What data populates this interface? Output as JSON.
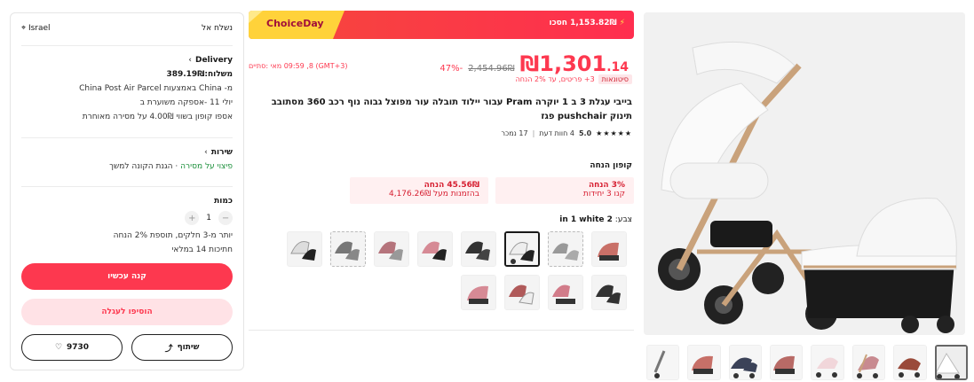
{
  "banner": {
    "brand": "ChoiceDay",
    "save_amount": "1,153.82₪ חסכו",
    "bolt": "⚡"
  },
  "price": {
    "current_main": "1,301",
    "current_cents": ".14",
    "currency": "₪",
    "original": "2,454.96₪",
    "discount": "-47%",
    "sale_end": "(GMT+3) 09:59 ,8 מאי :סתיים"
  },
  "tags": {
    "badge": "סיטונאות",
    "text": "3+ פריטים, עד 2% הנחה"
  },
  "title": "בייבי עגלת 3 ב 1 יוקרה Pram עבור יילוד תובלה עור מפוצל גבוה נוף רכב 360 מסתובב תינוק pushchair פגז",
  "rating": {
    "score": "5.0",
    "stars": "★★★★★",
    "reviews": "4 חוות דעת",
    "sold": "17 נמכר"
  },
  "coupons": {
    "label": "קופון הנחה",
    "a": {
      "line1": "3% הנחה",
      "line2": "קנו 3 יחידות"
    },
    "b": {
      "line1": "45.56₪ הנחה",
      "line2": "בהזמנות מעל 4,176.26₪"
    }
  },
  "color": {
    "label": "צבע:",
    "value": "2 in 1 white"
  },
  "panel": {
    "ship_to_label": "נשלח אל",
    "country": "Israel",
    "delivery_label": "Delivery",
    "shipping_cost": "משלוח:389.19₪",
    "ship_from": "מ- China באמצעות China Post Air Parcel",
    "eta": "יולי 11 -אספקה משוערת ב",
    "late_coupon": "אספו קופון בשווי 4.00₪ על מסירה מאוחרת",
    "service_label": "שירות",
    "service_text_green": "פיצוי על מסירה",
    "service_text_rest": " · הגנת הקונה למשך",
    "qty_label": "כמות",
    "qty_value": "1",
    "qty_minus": "−",
    "qty_plus": "+",
    "bulk_note": "יותר מ-3 חלקים, תוספת 2% הנחה",
    "ships_days": "חתיכות 14 במלאי",
    "buy_now": "קנה עכשיו",
    "add_to_cart": "הוסיפו לעגלה",
    "share": "שיתוף",
    "wish_count": "9730"
  },
  "icons": {
    "location": "location-pin-icon",
    "share": "share-icon",
    "heart": "heart-icon",
    "chevron": "chevron-right-icon"
  },
  "colors": {
    "accent": "#fd384f",
    "green": "#1b8f3a"
  }
}
